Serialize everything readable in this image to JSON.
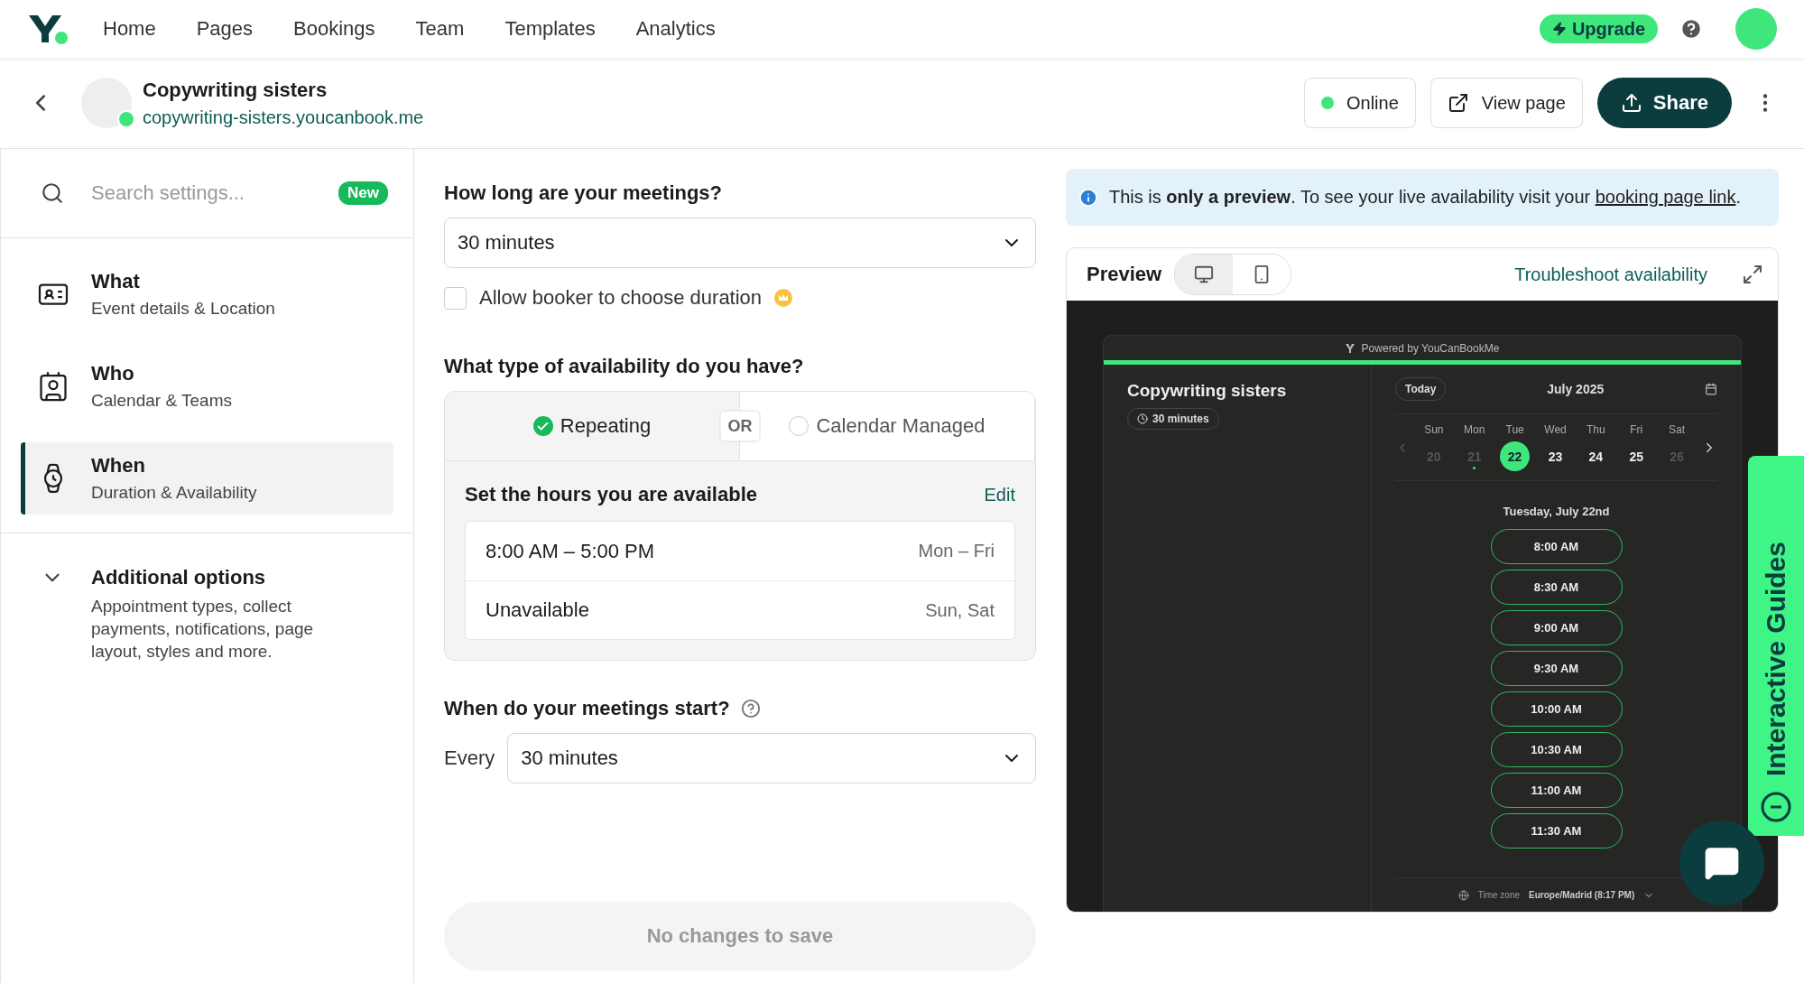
{
  "nav": {
    "items": [
      "Home",
      "Pages",
      "Bookings",
      "Team",
      "Templates",
      "Analytics"
    ],
    "upgrade": "Upgrade"
  },
  "header": {
    "title": "Copywriting sisters",
    "url": "copywriting-sisters.youcanbook.me",
    "status": "Online",
    "online": true,
    "view_page": "View page",
    "share": "Share"
  },
  "sidebar": {
    "search_placeholder": "Search settings...",
    "badge": "New",
    "items": [
      {
        "kind": "what",
        "title": "What",
        "subtitle": "Event details & Location",
        "selected": false
      },
      {
        "kind": "who",
        "title": "Who",
        "subtitle": "Calendar & Teams",
        "selected": false
      },
      {
        "kind": "when",
        "title": "When",
        "subtitle": "Duration & Availability",
        "selected": true
      }
    ],
    "additional": {
      "title": "Additional options",
      "text": "Appointment types, collect payments, notifications, page layout, styles and more."
    }
  },
  "form": {
    "duration_question": "How long are your meetings?",
    "duration_value": "30 minutes",
    "allow_duration": {
      "label": "Allow booker to choose duration",
      "checked": false
    },
    "availability_question": "What type of availability do you have?",
    "availability_options": [
      {
        "label": "Repeating",
        "selected": true
      },
      {
        "label": "Calendar Managed",
        "selected": false
      }
    ],
    "or_label": "OR",
    "hours_title": "Set the hours you are available",
    "edit": "Edit",
    "hours": [
      {
        "time": "8:00 AM – 5:00 PM",
        "days": "Mon – Fri"
      },
      {
        "time": "Unavailable",
        "days": "Sun, Sat"
      }
    ],
    "start_question": "When do your meetings start?",
    "every_label": "Every",
    "every_value": "30 minutes",
    "save": {
      "label": "No changes to save",
      "disabled": true
    }
  },
  "preview": {
    "notice_before": "This is **only a preview**. To see your live availability visit your",
    "notice_link": "booking page link",
    "notice_after": ".",
    "title": "Preview",
    "devices": [
      {
        "kind": "desktop",
        "selected": true
      },
      {
        "kind": "mobile",
        "selected": false
      }
    ],
    "troubleshoot": "Troubleshoot availability",
    "booking": {
      "powered": "Powered by YouCanBookMe",
      "name": "Copywriting sisters",
      "duration": "30 minutes",
      "today": "Today",
      "month": "July 2025",
      "days": [
        {
          "weekday": "Sun",
          "date": "20",
          "available": false,
          "selected": false,
          "today": false
        },
        {
          "weekday": "Mon",
          "date": "21",
          "available": false,
          "selected": false,
          "today": true
        },
        {
          "weekday": "Tue",
          "date": "22",
          "available": true,
          "selected": true,
          "today": false
        },
        {
          "weekday": "Wed",
          "date": "23",
          "available": true,
          "selected": false,
          "today": false
        },
        {
          "weekday": "Thu",
          "date": "24",
          "available": true,
          "selected": false,
          "today": false
        },
        {
          "weekday": "Fri",
          "date": "25",
          "available": true,
          "selected": false,
          "today": false
        },
        {
          "weekday": "Sat",
          "date": "26",
          "available": false,
          "selected": false,
          "today": false
        }
      ],
      "date_heading": "Tuesday, July 22nd",
      "slots": [
        "8:00 AM",
        "8:30 AM",
        "9:00 AM",
        "9:30 AM",
        "10:00 AM",
        "10:30 AM",
        "11:00 AM",
        "11:30 AM"
      ],
      "timezone_label": "Time zone",
      "timezone": "Europe/Madrid (8:17 PM)"
    }
  },
  "guides": "Interactive Guides"
}
